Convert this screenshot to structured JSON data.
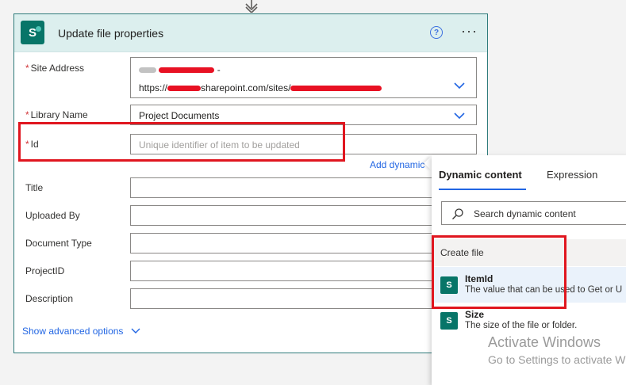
{
  "card": {
    "title": "Update file properties",
    "help_glyph": "?",
    "more_glyph": "···",
    "logo_letter": "S"
  },
  "fields": {
    "site_address": {
      "label": "Site Address",
      "required_mark": "*",
      "line1_suffix": "-",
      "line2_prefix": "https://",
      "line2_mid": "sharepoint.com/sites/"
    },
    "library_name": {
      "label": "Library Name",
      "required_mark": "*",
      "value": "Project Documents"
    },
    "id": {
      "label": "Id",
      "required_mark": "*",
      "placeholder": "Unique identifier of item to be updated"
    },
    "title": {
      "label": "Title",
      "value": ""
    },
    "uploaded_by": {
      "label": "Uploaded By",
      "value": ""
    },
    "document_type": {
      "label": "Document Type",
      "value": ""
    },
    "project_id": {
      "label": "ProjectID",
      "value": ""
    },
    "description": {
      "label": "Description",
      "value": ""
    }
  },
  "add_dynamic_link": "Add dynamic",
  "show_advanced": "Show advanced options",
  "panel": {
    "tabs": [
      "Dynamic content",
      "Expression"
    ],
    "active_tab": "Dynamic content",
    "search_placeholder": "Search dynamic content",
    "section": "Create file",
    "items": [
      {
        "title": "ItemId",
        "description": "The value that can be used to Get or U",
        "selected": true
      },
      {
        "title": "Size",
        "description": "The size of the file or folder.",
        "selected": false
      }
    ]
  },
  "watermark": {
    "line1": "Activate Windows",
    "line2": "Go to Settings to activate W"
  },
  "colors": {
    "accent": "#2266e3",
    "highlight_box": "#e0161f",
    "sharepoint": "#077568",
    "header_bg": "#dcefee"
  }
}
